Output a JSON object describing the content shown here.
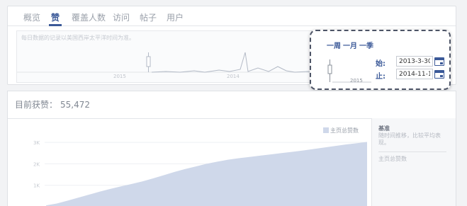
{
  "tabs": [
    {
      "label": "概览",
      "active": false
    },
    {
      "label": "赞",
      "active": true
    },
    {
      "label": "覆盖人数",
      "active": false
    },
    {
      "label": "访问",
      "active": false
    },
    {
      "label": "帖子",
      "active": false
    },
    {
      "label": "用户",
      "active": false
    }
  ],
  "overview": {
    "note": "每日数据的记录以美国西岸太平洋时间为准。",
    "year_labels": [
      "2015",
      "2014"
    ]
  },
  "date_popup": {
    "ranges": [
      "一周",
      "一月",
      "一季"
    ],
    "year_label": "2015",
    "start_label": "始:",
    "start_value": "2013-3-30",
    "end_label": "止:",
    "end_value": "2014-11-1"
  },
  "summary": {
    "label": "目前获赞：",
    "value": "55,472"
  },
  "chart_data": {
    "type": "area",
    "title": "",
    "legend": [
      {
        "name": "主页总赞数",
        "color": "#cfd8ea"
      }
    ],
    "y_ticks": [
      "3K",
      "2K",
      "1K"
    ],
    "ylim": [
      0,
      3500
    ],
    "series": [
      {
        "name": "主页总赞数",
        "color": "#cfd8ea",
        "values": [
          60,
          150,
          280,
          420,
          560,
          700,
          830,
          950,
          1060,
          1180,
          1320,
          1470,
          1620,
          1760,
          1880,
          2000,
          2100,
          2190,
          2260,
          2320,
          2380,
          2440,
          2500,
          2560,
          2620,
          2690,
          2760,
          2830,
          2900,
          2960,
          3020
        ]
      }
    ],
    "grid": true
  },
  "side_panel": {
    "title": "基准",
    "description": "随时间推移，比较平均表现。",
    "metric": "主页总赞数"
  }
}
